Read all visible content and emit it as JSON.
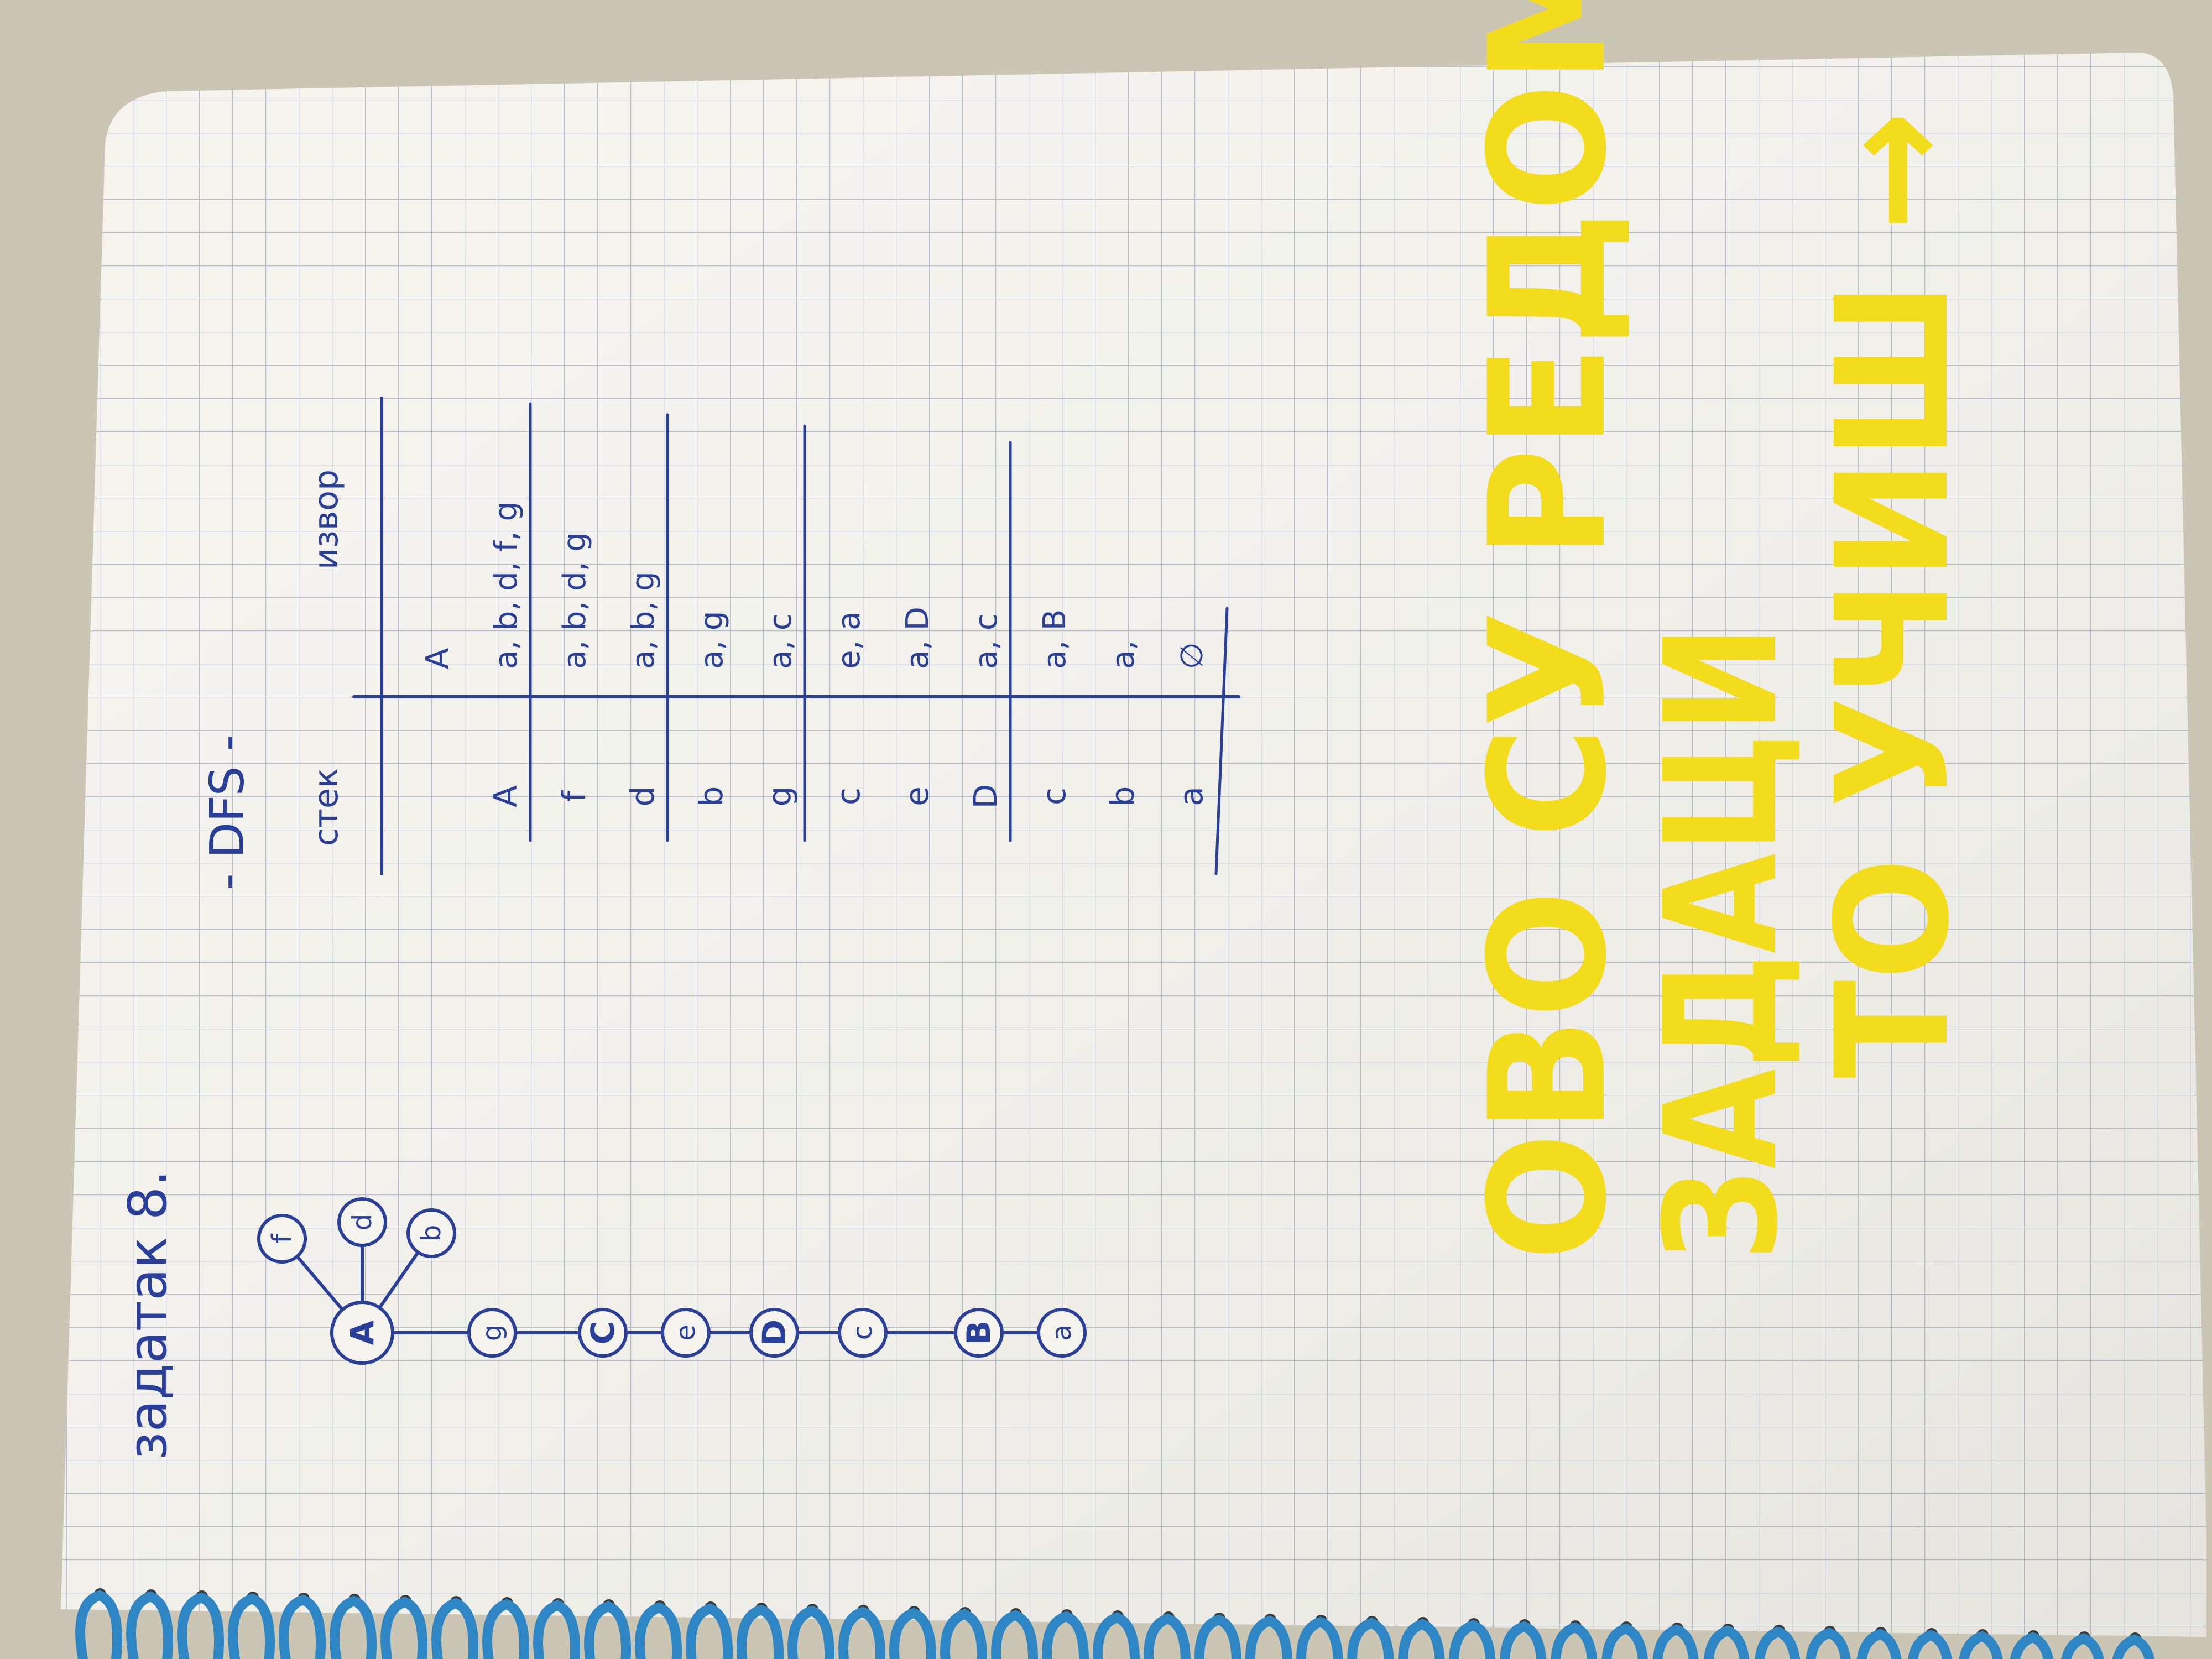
{
  "heading": "задатак 8.",
  "method_title": "- DFS -",
  "graph": {
    "hub": "A",
    "branches": [
      "f",
      "d",
      "b"
    ],
    "chain": [
      "g",
      "C",
      "e",
      "D",
      "c",
      "B",
      "a"
    ]
  },
  "table": {
    "col_stack": "стек",
    "col_source": "извор",
    "rows": [
      {
        "stack": "",
        "source": "A"
      },
      {
        "stack": "A",
        "source": "a, b, d, f, g"
      },
      {
        "stack": "f",
        "source": "a, b, d, g"
      },
      {
        "stack": "d",
        "source": "a, b, g"
      },
      {
        "stack": "b",
        "source": "a, g"
      },
      {
        "stack": "g",
        "source": "a, c"
      },
      {
        "stack": "c",
        "source": "e, a"
      },
      {
        "stack": "e",
        "source": "a, D"
      },
      {
        "stack": "D",
        "source": "a, c"
      },
      {
        "stack": "c",
        "source": "a, B"
      },
      {
        "stack": "b",
        "source": "a,"
      },
      {
        "stack": "a",
        "source": "∅"
      }
    ]
  },
  "note": {
    "line1": "ОВО СУ РЕДОМ",
    "line2": "ЗАДАЦИ",
    "line3": "ТО УЧИШ →"
  },
  "colors": {
    "ink": "#2a3f9a",
    "highlighter": "#f3dc1c",
    "spiral": "#2f86c4",
    "grid": "#b9bcc7"
  }
}
